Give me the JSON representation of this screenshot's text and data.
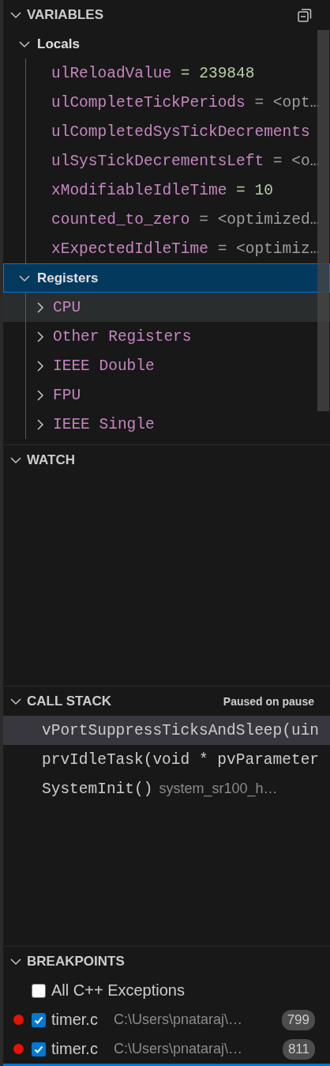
{
  "variables": {
    "title": "VARIABLES",
    "expanded": true,
    "scopes": [
      {
        "label": "Locals",
        "expanded": true,
        "selected": false,
        "children": [
          {
            "kind": "number",
            "name": "ulReloadValue",
            "value": "= 239848"
          },
          {
            "kind": "text",
            "name": "ulCompleteTickPeriods",
            "value": "= <opt…"
          },
          {
            "kind": "text",
            "name": "ulCompletedSysTickDecrements"
          },
          {
            "kind": "text",
            "name": "ulSysTickDecrementsLeft",
            "value": "= <o…"
          },
          {
            "kind": "number",
            "name": "xModifiableIdleTime",
            "value": "= 10"
          },
          {
            "kind": "text",
            "name": "counted_to_zero",
            "value": "= <optimized…"
          },
          {
            "kind": "text",
            "name": "xExpectedIdleTime",
            "value": "= <optimiz…"
          }
        ]
      },
      {
        "label": "Registers",
        "expanded": true,
        "selected": true,
        "children": [
          {
            "kind": "group",
            "name": "CPU",
            "expanded": false,
            "highlighted": true
          },
          {
            "kind": "group",
            "name": "Other Registers",
            "expanded": false,
            "highlighted": false
          },
          {
            "kind": "group",
            "name": "IEEE Double",
            "expanded": false,
            "highlighted": false
          },
          {
            "kind": "group",
            "name": "FPU",
            "expanded": false,
            "highlighted": false
          },
          {
            "kind": "group",
            "name": "IEEE Single",
            "expanded": false,
            "highlighted": false
          }
        ]
      }
    ]
  },
  "watch": {
    "title": "WATCH",
    "expanded": true
  },
  "call_stack": {
    "title": "CALL STACK",
    "expanded": true,
    "status": "Paused on pause",
    "frames": [
      {
        "function": "vPortSuppressTicksAndSleep(uin",
        "selected": true
      },
      {
        "function": "prvIdleTask(void * pvParameter",
        "selected": false
      },
      {
        "function": "SystemInit()",
        "file": "system_sr100_h…",
        "selected": false
      }
    ]
  },
  "breakpoints": {
    "title": "BREAKPOINTS",
    "expanded": true,
    "items": [
      {
        "kind": "exception",
        "label": "All C++ Exceptions",
        "checked": false
      },
      {
        "kind": "line",
        "label": "timer.c",
        "path": "C:\\Users\\pnataraj\\…",
        "line": "799",
        "checked": true
      },
      {
        "kind": "line",
        "label": "timer.c",
        "path": "C:\\Users\\pnataraj\\…",
        "line": "811",
        "checked": true
      }
    ]
  }
}
